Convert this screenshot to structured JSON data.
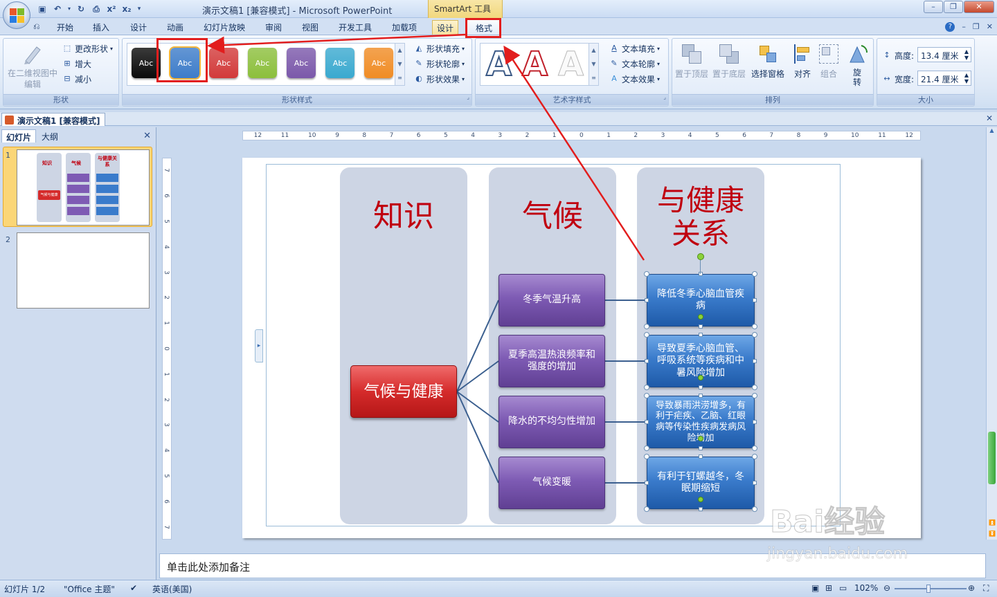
{
  "window": {
    "title": "演示文稿1 [兼容模式] - Microsoft PowerPoint",
    "context_tab_header": "SmartArt 工具"
  },
  "ribbon_tabs": [
    "开始",
    "插入",
    "设计",
    "动画",
    "幻灯片放映",
    "审阅",
    "视图",
    "开发工具",
    "加载项"
  ],
  "context_tabs": {
    "design": "设计",
    "format": "格式"
  },
  "groups": {
    "shape": {
      "label": "形状",
      "edit_2d": "在二维视图中编辑",
      "change_shape": "更改形状",
      "larger": "增大",
      "smaller": "减小"
    },
    "shape_styles": {
      "label": "形状样式",
      "style_sample_text": "Abc",
      "fill": "形状填充",
      "outline": "形状轮廓",
      "effects": "形状效果"
    },
    "wordart_styles": {
      "label": "艺术字样式",
      "sample": "A",
      "text_fill": "文本填充",
      "text_outline": "文本轮廓",
      "text_effects": "文本效果"
    },
    "arrange": {
      "label": "排列",
      "bring_front": "置于顶层",
      "send_back": "置于底层",
      "selection_pane": "选择窗格",
      "align": "对齐",
      "group": "组合",
      "rotate": "旋转"
    },
    "size": {
      "label": "大小",
      "height_label": "高度:",
      "height_value": "13.4 厘米",
      "width_label": "宽度:",
      "width_value": "21.4 厘米"
    }
  },
  "style_colors": [
    "#0a0a0a",
    "#3d7cc9",
    "#d23a3a",
    "#8cbf3c",
    "#7b58aa",
    "#3aa9cf",
    "#f08c25"
  ],
  "document_tab": "演示文稿1 [兼容模式]",
  "left_pane": {
    "tab_slides": "幻灯片",
    "tab_outline": "大纲",
    "slide_numbers": [
      "1",
      "2"
    ]
  },
  "ruler": {
    "h_labels": [
      "12",
      "11",
      "10",
      "9",
      "8",
      "7",
      "6",
      "5",
      "4",
      "3",
      "2",
      "1",
      "0",
      "1",
      "2",
      "3",
      "4",
      "5",
      "6",
      "7",
      "8",
      "9",
      "10",
      "11",
      "12"
    ],
    "v_labels": [
      "7",
      "6",
      "5",
      "4",
      "3",
      "2",
      "1",
      "0",
      "1",
      "2",
      "3",
      "4",
      "5",
      "6",
      "7"
    ]
  },
  "smartart": {
    "col_knowledge": "知识",
    "col_climate": "气候",
    "col_health": "与健康关系",
    "root": "气候与健康",
    "climate_items": [
      "冬季气温升高",
      "夏季高温热浪频率和强度的增加",
      "降水的不均匀性增加",
      "气候变暖"
    ],
    "health_items": [
      "降低冬季心脑血管疾病",
      "导致夏季心脑血管、呼吸系统等疾病和中暑风险增加",
      "导致暴雨洪涝增多，有利于疟疾、乙脑、红眼病等传染性疾病发病风险增加",
      "有利于钉螺越冬，冬眠期缩短"
    ],
    "thumb_text": {
      "col_knowledge": "知识",
      "col_climate": "气候",
      "col_health": "与健康关系",
      "root": "气候与健康"
    }
  },
  "notes_placeholder": "单击此处添加备注",
  "status": {
    "slide_pos": "幻灯片 1/2",
    "theme": "\"Office 主题\"",
    "language": "英语(美国)",
    "zoom": "102%"
  },
  "colors": {
    "title_red": "#c0000f",
    "purple": "#7e5bb4",
    "blue": "#3a7bcb",
    "root_red": "#d52b2b",
    "annotation_red": "#e21d1d"
  },
  "watermark": {
    "brand": "Bai经验",
    "url": "jingyan.baidu.com"
  }
}
